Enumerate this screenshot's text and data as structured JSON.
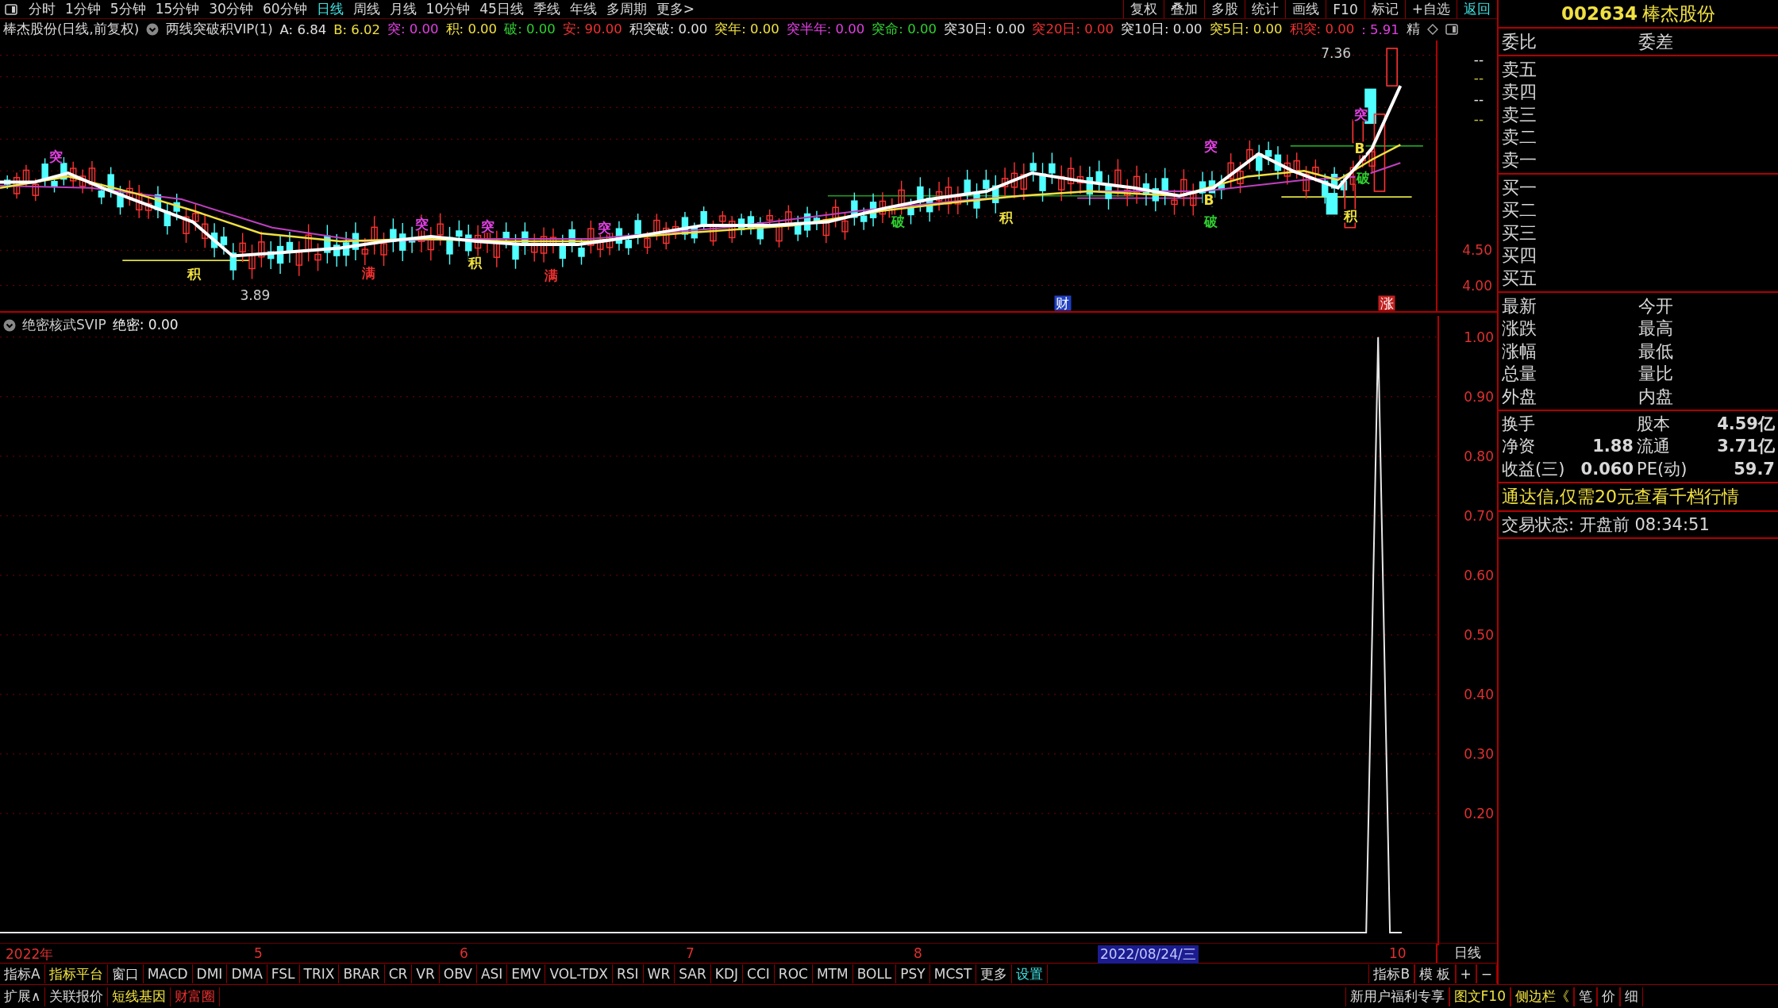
{
  "toolbar": {
    "tabs": [
      {
        "label": "分时",
        "selected": false
      },
      {
        "label": "1分钟",
        "selected": false
      },
      {
        "label": "5分钟",
        "selected": false
      },
      {
        "label": "15分钟",
        "selected": false
      },
      {
        "label": "30分钟",
        "selected": false
      },
      {
        "label": "60分钟",
        "selected": false
      },
      {
        "label": "日线",
        "selected": true
      },
      {
        "label": "周线",
        "selected": false
      },
      {
        "label": "月线",
        "selected": false
      },
      {
        "label": "10分钟",
        "selected": false
      },
      {
        "label": "45日线",
        "selected": false
      },
      {
        "label": "季线",
        "selected": false
      },
      {
        "label": "年线",
        "selected": false
      },
      {
        "label": "多周期",
        "selected": false
      },
      {
        "label": "更多>",
        "selected": false
      }
    ],
    "buttons": [
      {
        "label": "复权",
        "accent": false
      },
      {
        "label": "叠加",
        "accent": false
      },
      {
        "label": "多股",
        "accent": false
      },
      {
        "label": "统计",
        "accent": false
      },
      {
        "label": "画线",
        "accent": false
      },
      {
        "label": "F10",
        "accent": false
      },
      {
        "label": "标记",
        "accent": false
      },
      {
        "label": "+自选",
        "accent": false
      },
      {
        "label": "返回",
        "accent": true
      }
    ]
  },
  "legend": {
    "title": "棒杰股份(日线,前复权)",
    "indicator": "两线突破积VIP(1)",
    "items": [
      {
        "text": "A: 6.84",
        "color": "#e0e0e0"
      },
      {
        "text": "B: 6.02",
        "color": "#f0e040"
      },
      {
        "text": "突: 0.00",
        "color": "#e040e0"
      },
      {
        "text": "积: 0.00",
        "color": "#f0e040"
      },
      {
        "text": "破: 0.00",
        "color": "#30d030"
      },
      {
        "text": "安: 90.00",
        "color": "#f03030"
      },
      {
        "text": "积突破: 0.00",
        "color": "#e0e0e0"
      },
      {
        "text": "突年: 0.00",
        "color": "#f0e040"
      },
      {
        "text": "突半年: 0.00",
        "color": "#e040e0"
      },
      {
        "text": "突命: 0.00",
        "color": "#30d030"
      },
      {
        "text": "突30日: 0.00",
        "color": "#e0e0e0"
      },
      {
        "text": "突20日: 0.00",
        "color": "#f03030"
      },
      {
        "text": "突10日: 0.00",
        "color": "#e0e0e0"
      },
      {
        "text": "突5日: 0.00",
        "color": "#f0e040"
      },
      {
        "text": "积突: 0.00",
        "color": "#f03030"
      },
      {
        "text": ": 5.91",
        "color": "#e040e0"
      }
    ],
    "tail": "精"
  },
  "price_chart": {
    "markers": [
      {
        "text": "突",
        "kind": "plain",
        "color": "#e040e0"
      },
      {
        "text": "积",
        "kind": "plain",
        "color": "#f0e040"
      },
      {
        "text": "满",
        "kind": "plain",
        "color": "#f03030"
      },
      {
        "text": "突",
        "kind": "plain",
        "color": "#e040e0"
      },
      {
        "text": "积",
        "kind": "plain",
        "color": "#f0e040"
      },
      {
        "text": "突",
        "kind": "plain",
        "color": "#e040e0"
      },
      {
        "text": "满",
        "kind": "plain",
        "color": "#f03030"
      },
      {
        "text": "突",
        "kind": "plain",
        "color": "#e040e0"
      },
      {
        "text": "破",
        "kind": "plain",
        "color": "#30d030"
      },
      {
        "text": "积",
        "kind": "plain",
        "color": "#f0e040"
      },
      {
        "text": "突",
        "kind": "plain",
        "color": "#e040e0"
      },
      {
        "text": "B",
        "kind": "plain",
        "color": "#f0e040"
      },
      {
        "text": "破",
        "kind": "plain",
        "color": "#30d030"
      },
      {
        "text": "突",
        "kind": "plain",
        "color": "#e040e0"
      },
      {
        "text": "B",
        "kind": "plain",
        "color": "#f0e040"
      },
      {
        "text": "破",
        "kind": "plain",
        "color": "#30d030"
      },
      {
        "text": "积",
        "kind": "plain",
        "color": "#f0e040"
      },
      {
        "text": "财",
        "kind": "badge",
        "color": "#2040c0"
      },
      {
        "text": "涨",
        "kind": "badge",
        "color": "#c02020"
      }
    ],
    "high_label": "7.36",
    "low_label": "3.89",
    "axis_dashes": [
      {
        "text": "--",
        "color": "#e0e0e0"
      },
      {
        "text": "--",
        "color": "#c0c040"
      },
      {
        "text": "--",
        "color": "#e0e0e0"
      },
      {
        "text": "--",
        "color": "#c0c040"
      }
    ],
    "yticks": [
      "4.50",
      "4.00"
    ]
  },
  "indicator_pane": {
    "title": "绝密核武SVIP",
    "reading": ": 0.00",
    "chart_data": {
      "type": "line",
      "grid": true,
      "ylim": [
        -0.016,
        1.041
      ],
      "yticks": [
        {
          "value": 1,
          "label": "1.00"
        },
        {
          "value": 0.9,
          "label": "0.90"
        },
        {
          "value": 0.8,
          "label": "0.80"
        },
        {
          "value": 0.7,
          "label": "0.70"
        },
        {
          "value": 0.6,
          "label": "0.60"
        },
        {
          "value": 0.5,
          "label": "0.50"
        },
        {
          "value": 0.4,
          "label": "0.40"
        },
        {
          "value": 0.3,
          "label": "0.30"
        },
        {
          "value": 0.2,
          "label": "0.20"
        }
      ],
      "series": [
        {
          "name": "绝密",
          "color": "#e8e8e8",
          "values": [
            0,
            0,
            0,
            0,
            0,
            0,
            0,
            0,
            0,
            0,
            0,
            0,
            0,
            0,
            0,
            0,
            0,
            0,
            0,
            0,
            0,
            0,
            0,
            0,
            0,
            0,
            0,
            0,
            0,
            0,
            0,
            0,
            0,
            0,
            0,
            0,
            0,
            0,
            0,
            0,
            0,
            0,
            0,
            0,
            0,
            0,
            0,
            0,
            0,
            0,
            0,
            0,
            0,
            0,
            0,
            0,
            0,
            0,
            0,
            0,
            0,
            0,
            0,
            0,
            0,
            0,
            0,
            0,
            0,
            0,
            0,
            0,
            0,
            0,
            0,
            0,
            0,
            0,
            0,
            0,
            0,
            0,
            0,
            0,
            0,
            0,
            0,
            0,
            0,
            0,
            0,
            0,
            0,
            0,
            0,
            0,
            0,
            0,
            0,
            0,
            0,
            0,
            0,
            0,
            0,
            0,
            0,
            0,
            0,
            0,
            0,
            0,
            0,
            0,
            0,
            0,
            1,
            0,
            0,
            null,
            null,
            null
          ]
        }
      ]
    }
  },
  "time_axis": {
    "labels": [
      {
        "text": "2022年",
        "highlighted": false
      },
      {
        "text": "5",
        "highlighted": false
      },
      {
        "text": "6",
        "highlighted": false
      },
      {
        "text": "7",
        "highlighted": false
      },
      {
        "text": "8",
        "highlighted": false
      },
      {
        "text": "2022/08/24/三",
        "highlighted": true
      },
      {
        "text": "10",
        "highlighted": false
      }
    ],
    "period": "日线"
  },
  "indicator_tabs": {
    "left": [
      {
        "label": "指标A",
        "color": "#d8d8d8"
      },
      {
        "label": "指标平台",
        "color": "#f0e040"
      },
      {
        "label": "窗口",
        "color": "#d8d8d8"
      },
      {
        "label": "MACD",
        "color": "#d8d8d8"
      },
      {
        "label": "DMI",
        "color": "#d8d8d8"
      },
      {
        "label": "DMA",
        "color": "#d8d8d8"
      },
      {
        "label": "FSL",
        "color": "#d8d8d8"
      },
      {
        "label": "TRIX",
        "color": "#d8d8d8"
      },
      {
        "label": "BRAR",
        "color": "#d8d8d8"
      },
      {
        "label": "CR",
        "color": "#d8d8d8"
      },
      {
        "label": "VR",
        "color": "#d8d8d8"
      },
      {
        "label": "OBV",
        "color": "#d8d8d8"
      },
      {
        "label": "ASI",
        "color": "#d8d8d8"
      },
      {
        "label": "EMV",
        "color": "#d8d8d8"
      },
      {
        "label": "VOL-TDX",
        "color": "#d8d8d8"
      },
      {
        "label": "RSI",
        "color": "#d8d8d8"
      },
      {
        "label": "WR",
        "color": "#d8d8d8"
      },
      {
        "label": "SAR",
        "color": "#d8d8d8"
      },
      {
        "label": "KDJ",
        "color": "#d8d8d8"
      },
      {
        "label": "CCI",
        "color": "#d8d8d8"
      },
      {
        "label": "ROC",
        "color": "#d8d8d8"
      },
      {
        "label": "MTM",
        "color": "#d8d8d8"
      },
      {
        "label": "BOLL",
        "color": "#d8d8d8"
      },
      {
        "label": "PSY",
        "color": "#d8d8d8"
      },
      {
        "label": "MCST",
        "color": "#d8d8d8"
      },
      {
        "label": "更多",
        "color": "#d8d8d8"
      },
      {
        "label": "设置",
        "color": "#40e0e0"
      }
    ],
    "right": [
      "指标B",
      "模 板",
      "+",
      "−"
    ]
  },
  "bottom_bar": {
    "left": [
      {
        "label": "扩展∧",
        "color": "#d8d8d8"
      },
      {
        "label": "关联报价",
        "color": "#d8d8d8"
      },
      {
        "label": "短线基因",
        "color": "#f0e040"
      },
      {
        "label": "财富圈",
        "color": "#f03030"
      }
    ],
    "right": [
      {
        "label": "新用户福利专享",
        "color": "#d8d8d8"
      },
      {
        "label": "图文F10",
        "color": "#f0e040"
      },
      {
        "label": "侧边栏《",
        "color": "#f0e040"
      },
      {
        "label": "笔",
        "color": "#d8d8d8"
      },
      {
        "label": "价",
        "color": "#d8d8d8"
      },
      {
        "label": "细",
        "color": "#d8d8d8"
      }
    ]
  },
  "quote_panel": {
    "code": "002634",
    "name": "棒杰股份",
    "header": [
      "委比",
      "委差"
    ],
    "asks": [
      "卖五",
      "卖四",
      "卖三",
      "卖二",
      "卖一"
    ],
    "bids": [
      "买一",
      "买二",
      "买三",
      "买四",
      "买五"
    ],
    "fields": [
      [
        "最新",
        "今开"
      ],
      [
        "涨跌",
        "最高"
      ],
      [
        "涨幅",
        "最低"
      ],
      [
        "总量",
        "量比"
      ],
      [
        "外盘",
        "内盘"
      ]
    ],
    "stats": [
      [
        {
          "label": "换手"
        },
        {
          "label": "股本",
          "value": "4.59亿"
        }
      ],
      [
        {
          "label": "净资",
          "value": "1.88"
        },
        {
          "label": "流通",
          "value": "3.71亿"
        }
      ],
      [
        {
          "label": "收益(三)",
          "value": "0.060"
        },
        {
          "label": "PE(动)",
          "value": "59.7"
        }
      ]
    ],
    "promo": "通达信,仅需20元查看千档行情",
    "status": "交易状态: 开盘前 08:34:51"
  }
}
